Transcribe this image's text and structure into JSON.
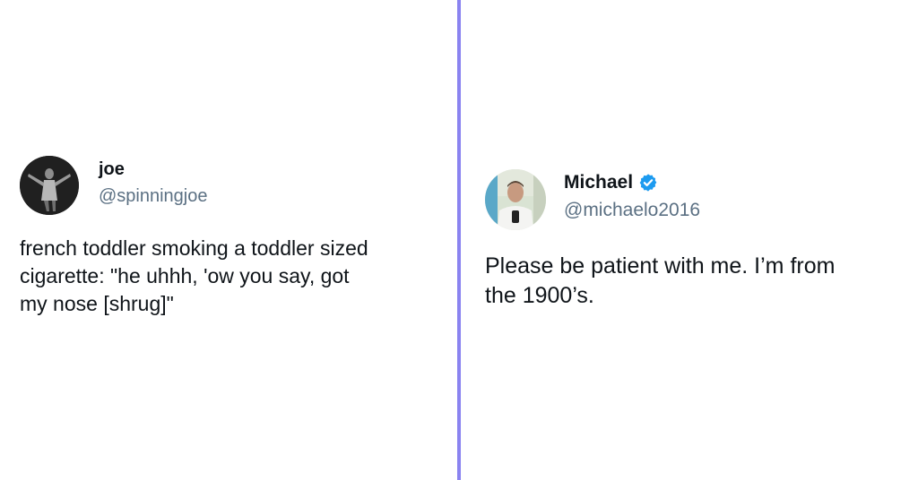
{
  "colors": {
    "divider": "#8a83f0",
    "handle": "#5b7083",
    "text": "#0f1419",
    "verified": "#1d9bf0"
  },
  "tweets": [
    {
      "display_name": "joe",
      "handle": "@spinningjoe",
      "verified": false,
      "avatar_icon": "avatar-photo-dark-figure",
      "text": "french toddler smoking a toddler sized\ncigarette: \"he uhhh, 'ow you say, got\nmy nose [shrug]\""
    },
    {
      "display_name": "Michael",
      "handle": "@michaelo2016",
      "verified": true,
      "verified_icon": "verified-badge-icon",
      "avatar_icon": "avatar-photo-man-white-shirt",
      "text": "Please be patient with me.  I’m from\nthe 1900’s."
    }
  ]
}
